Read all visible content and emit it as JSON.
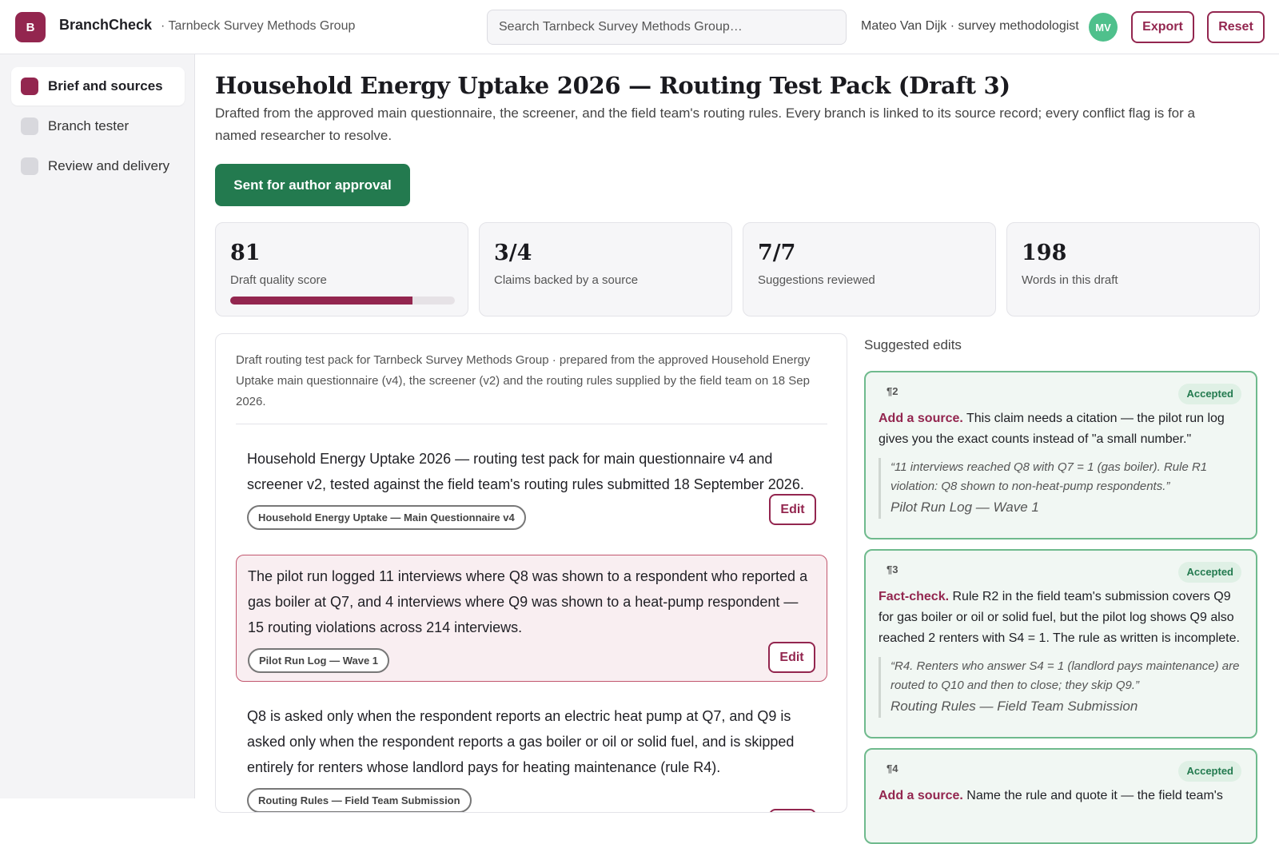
{
  "app": {
    "logo_letter": "B",
    "name": "BranchCheck",
    "org": "· Tarnbeck Survey Methods Group"
  },
  "search": {
    "placeholder": "Search Tarnbeck Survey Methods Group…"
  },
  "user": {
    "label": "Mateo Van Dijk · survey methodologist",
    "initials": "MV"
  },
  "header_actions": {
    "export": "Export",
    "reset": "Reset"
  },
  "sidebar": {
    "items": [
      {
        "label": "Brief and sources",
        "active": true
      },
      {
        "label": "Branch tester",
        "active": false
      },
      {
        "label": "Review and delivery",
        "active": false
      }
    ]
  },
  "page": {
    "title": "Household Energy Uptake 2026 — Routing Test Pack (Draft 3)",
    "description": "Drafted from the approved main questionnaire, the screener, and the field team's routing rules. Every branch is linked to its source record; every conflict flag is for a named researcher to resolve.",
    "status_button": "Sent for author approval"
  },
  "stats": [
    {
      "value": "81",
      "label": "Draft quality score",
      "progress": 0.81
    },
    {
      "value": "3/4",
      "label": "Claims backed by a source"
    },
    {
      "value": "7/7",
      "label": "Suggestions reviewed"
    },
    {
      "value": "198",
      "label": "Words in this draft"
    }
  ],
  "draft": {
    "intro": "Draft routing test pack for Tarnbeck Survey Methods Group · prepared from the approved Household Energy Uptake main questionnaire (v4), the screener (v2) and the routing rules supplied by the field team on 18 Sep 2026.",
    "edit_label": "Edit",
    "paragraphs": [
      {
        "text": "Household Energy Uptake 2026 — routing test pack for main questionnaire v4 and screener v2, tested against the field team's routing rules submitted 18 September 2026.",
        "source": "Household Energy Uptake — Main Questionnaire v4"
      },
      {
        "text": "The pilot run logged 11 interviews where Q8 was shown to a respondent who reported a gas boiler at Q7, and 4 interviews where Q9 was shown to a heat-pump respondent — 15 routing violations across 214 interviews.",
        "source": "Pilot Run Log — Wave 1",
        "flagged": true
      },
      {
        "text": "Q8 is asked only when the respondent reports an electric heat pump at Q7, and Q9 is asked only when the respondent reports a gas boiler or oil or solid fuel, and is skipped entirely for renters whose landlord pays for heating maintenance (rule R4).",
        "source": "Routing Rules — Field Team Submission"
      }
    ]
  },
  "suggestions": {
    "title": "Suggested edits",
    "items": [
      {
        "para": "¶2",
        "status": "Accepted",
        "kind": "Add a source.",
        "body": "This claim needs a citation — the pilot run log gives you the exact counts instead of \"a small number.\"",
        "quote": "“11 interviews reached Q8 with Q7 = 1 (gas boiler). Rule R1 violation: Q8 shown to non-heat-pump respondents.”",
        "quote_source": "Pilot Run Log — Wave 1"
      },
      {
        "para": "¶3",
        "status": "Accepted",
        "kind": "Fact-check.",
        "body": "Rule R2 in the field team's submission covers Q9 for gas boiler or oil or solid fuel, but the pilot log shows Q9 also reached 2 renters with S4 = 1. The rule as written is incomplete.",
        "quote": "“R4. Renters who answer S4 = 1 (landlord pays maintenance) are routed to Q10 and then to close; they skip Q9.”",
        "quote_source": "Routing Rules — Field Team Submission"
      },
      {
        "para": "¶4",
        "status": "Accepted",
        "kind": "Add a source.",
        "body": "Name the rule and quote it — the field team's"
      }
    ]
  },
  "colors": {
    "accent": "#93264f",
    "success": "#237a4f",
    "avatar": "#4fc08c"
  }
}
